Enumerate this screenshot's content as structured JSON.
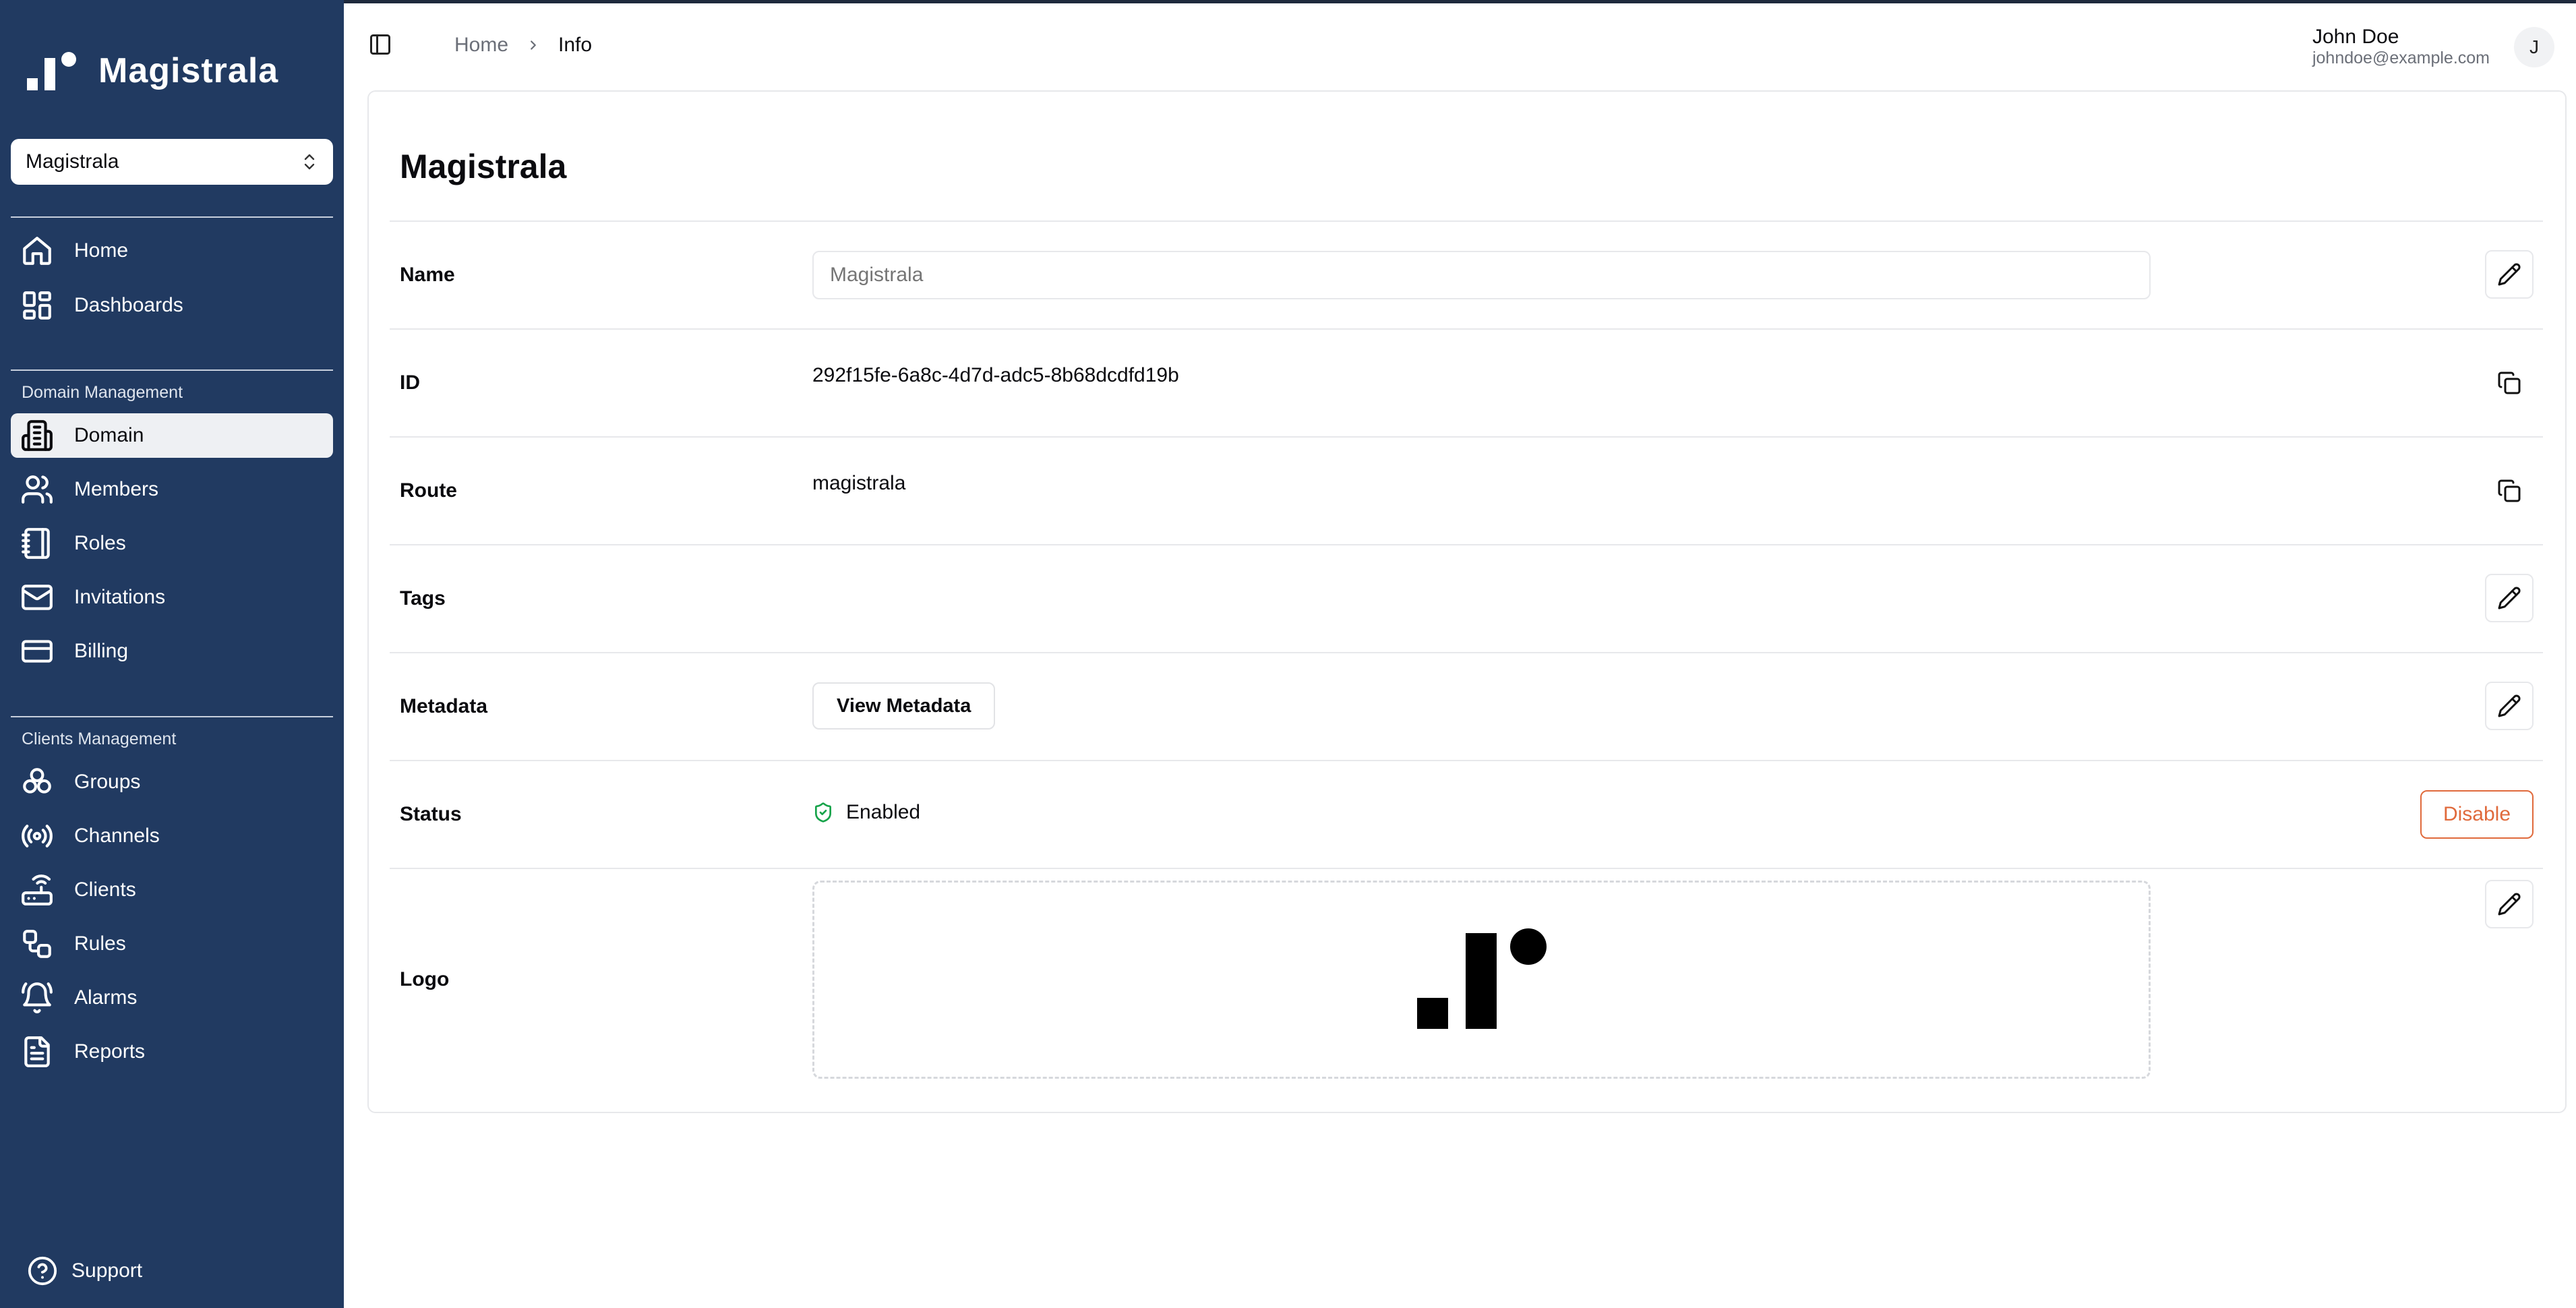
{
  "app": {
    "name": "Magistrala"
  },
  "sidebar": {
    "domain_select": {
      "value": "Magistrala"
    },
    "main_items": [
      {
        "label": "Home",
        "icon": "home-icon"
      },
      {
        "label": "Dashboards",
        "icon": "dashboard-icon"
      }
    ],
    "domain_section": {
      "title": "Domain Management",
      "items": [
        {
          "label": "Domain",
          "icon": "building-icon",
          "active": true
        },
        {
          "label": "Members",
          "icon": "users-icon"
        },
        {
          "label": "Roles",
          "icon": "notebook-icon"
        },
        {
          "label": "Invitations",
          "icon": "mail-icon"
        },
        {
          "label": "Billing",
          "icon": "credit-card-icon"
        }
      ]
    },
    "clients_section": {
      "title": "Clients Management",
      "items": [
        {
          "label": "Groups",
          "icon": "groups-icon"
        },
        {
          "label": "Channels",
          "icon": "radio-icon"
        },
        {
          "label": "Clients",
          "icon": "router-icon"
        },
        {
          "label": "Rules",
          "icon": "workflow-icon"
        },
        {
          "label": "Alarms",
          "icon": "bell-icon"
        },
        {
          "label": "Reports",
          "icon": "file-text-icon"
        }
      ]
    },
    "support": {
      "label": "Support",
      "icon": "help-circle-icon"
    }
  },
  "header": {
    "breadcrumb": {
      "home": "Home",
      "current": "Info"
    },
    "user": {
      "name": "John Doe",
      "email": "johndoe@example.com",
      "initial": "J"
    }
  },
  "main": {
    "title": "Magistrala",
    "fields": {
      "name": {
        "label": "Name",
        "placeholder": "Magistrala"
      },
      "id": {
        "label": "ID",
        "value": "292f15fe-6a8c-4d7d-adc5-8b68dcdfd19b"
      },
      "route": {
        "label": "Route",
        "value": "magistrala"
      },
      "tags": {
        "label": "Tags"
      },
      "metadata": {
        "label": "Metadata",
        "button": "View Metadata"
      },
      "status": {
        "label": "Status",
        "value": "Enabled",
        "action": "Disable"
      },
      "logo": {
        "label": "Logo"
      }
    }
  },
  "colors": {
    "sidebar_bg": "#213a61",
    "status_enabled": "#16a34a",
    "disable_accent": "#e06a3c"
  }
}
